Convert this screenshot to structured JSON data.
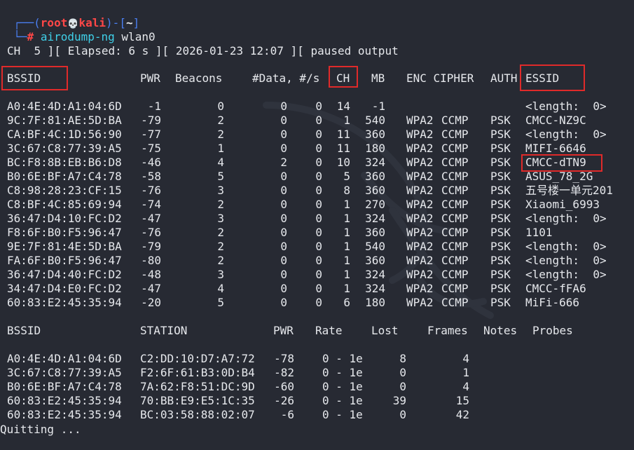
{
  "prompt": {
    "bracket_open": "┌──(",
    "user": "root",
    "skull": "💀",
    "host": "kali",
    "bracket_mid": ")-[",
    "cwd": "~",
    "bracket_close": "]",
    "corner": "└─",
    "hash": "#",
    "command": "airodump-ng",
    "arg": "wlan0"
  },
  "status_line": "CH  5 ][ Elapsed: 6 s ][ 2026-01-23 12:07 ][ paused output",
  "ap_table": {
    "headers": {
      "bssid": "BSSID",
      "pwr": "PWR",
      "beacons": "Beacons",
      "data": "#Data, #/s",
      "ch": "CH",
      "mb": "MB",
      "enc_cipher": "ENC CIPHER",
      "auth": "AUTH",
      "essid": "ESSID"
    },
    "rows": [
      {
        "bssid": "A0:4E:4D:A1:04:6D",
        "pwr": "-1",
        "beacons": "0",
        "data": "0",
        "per_s": "0",
        "ch": "14",
        "mb": "-1",
        "enc": "",
        "cipher": "",
        "auth": "",
        "essid": "<length:  0>"
      },
      {
        "bssid": "9C:7F:81:AE:5D:BA",
        "pwr": "-79",
        "beacons": "2",
        "data": "0",
        "per_s": "0",
        "ch": "1",
        "mb": "540",
        "enc": "WPA2",
        "cipher": "CCMP",
        "auth": "PSK",
        "essid": "CMCC-NZ9C"
      },
      {
        "bssid": "CA:BF:4C:1D:56:90",
        "pwr": "-77",
        "beacons": "2",
        "data": "0",
        "per_s": "0",
        "ch": "11",
        "mb": "360",
        "enc": "WPA2",
        "cipher": "CCMP",
        "auth": "PSK",
        "essid": "<length:  0>"
      },
      {
        "bssid": "3C:67:C8:77:39:A5",
        "pwr": "-75",
        "beacons": "1",
        "data": "0",
        "per_s": "0",
        "ch": "11",
        "mb": "180",
        "enc": "WPA2",
        "cipher": "CCMP",
        "auth": "PSK",
        "essid": "MIFI-6646"
      },
      {
        "bssid": "BC:F8:8B:EB:B6:D8",
        "pwr": "-46",
        "beacons": "4",
        "data": "2",
        "per_s": "0",
        "ch": "10",
        "mb": "324",
        "enc": "WPA2",
        "cipher": "CCMP",
        "auth": "PSK",
        "essid": "CMCC-dTN9"
      },
      {
        "bssid": "B0:6E:BF:A7:C4:78",
        "pwr": "-58",
        "beacons": "5",
        "data": "0",
        "per_s": "0",
        "ch": "5",
        "mb": "360",
        "enc": "WPA2",
        "cipher": "CCMP",
        "auth": "PSK",
        "essid": "ASUS_78_2G"
      },
      {
        "bssid": "C8:98:28:23:CF:15",
        "pwr": "-76",
        "beacons": "3",
        "data": "0",
        "per_s": "0",
        "ch": "8",
        "mb": "360",
        "enc": "WPA2",
        "cipher": "CCMP",
        "auth": "PSK",
        "essid": "五号楼一单元201"
      },
      {
        "bssid": "C8:BF:4C:85:69:94",
        "pwr": "-74",
        "beacons": "2",
        "data": "0",
        "per_s": "0",
        "ch": "1",
        "mb": "270",
        "enc": "WPA2",
        "cipher": "CCMP",
        "auth": "PSK",
        "essid": "Xiaomi_6993"
      },
      {
        "bssid": "36:47:D4:10:FC:D2",
        "pwr": "-47",
        "beacons": "3",
        "data": "0",
        "per_s": "0",
        "ch": "1",
        "mb": "324",
        "enc": "WPA2",
        "cipher": "CCMP",
        "auth": "PSK",
        "essid": "<length:  0>"
      },
      {
        "bssid": "F8:6F:B0:F5:96:47",
        "pwr": "-76",
        "beacons": "2",
        "data": "0",
        "per_s": "0",
        "ch": "1",
        "mb": "360",
        "enc": "WPA2",
        "cipher": "CCMP",
        "auth": "PSK",
        "essid": "1101"
      },
      {
        "bssid": "9E:7F:81:4E:5D:BA",
        "pwr": "-79",
        "beacons": "2",
        "data": "0",
        "per_s": "0",
        "ch": "1",
        "mb": "540",
        "enc": "WPA2",
        "cipher": "CCMP",
        "auth": "PSK",
        "essid": "<length:  0>"
      },
      {
        "bssid": "FA:6F:B0:F5:96:47",
        "pwr": "-80",
        "beacons": "2",
        "data": "0",
        "per_s": "0",
        "ch": "1",
        "mb": "360",
        "enc": "WPA2",
        "cipher": "CCMP",
        "auth": "PSK",
        "essid": "<length:  0>"
      },
      {
        "bssid": "36:47:D4:40:FC:D2",
        "pwr": "-48",
        "beacons": "3",
        "data": "0",
        "per_s": "0",
        "ch": "1",
        "mb": "324",
        "enc": "WPA2",
        "cipher": "CCMP",
        "auth": "PSK",
        "essid": "<length:  0>"
      },
      {
        "bssid": "34:47:D4:E0:FC:D2",
        "pwr": "-47",
        "beacons": "4",
        "data": "0",
        "per_s": "0",
        "ch": "1",
        "mb": "324",
        "enc": "WPA2",
        "cipher": "CCMP",
        "auth": "PSK",
        "essid": "CMCC-fFA6"
      },
      {
        "bssid": "60:83:E2:45:35:94",
        "pwr": "-20",
        "beacons": "5",
        "data": "0",
        "per_s": "0",
        "ch": "6",
        "mb": "180",
        "enc": "WPA2",
        "cipher": "CCMP",
        "auth": "PSK",
        "essid": "MiFi-666"
      }
    ]
  },
  "station_table": {
    "headers": {
      "bssid": "BSSID",
      "station": "STATION",
      "pwr": "PWR",
      "rate": "Rate",
      "lost": "Lost",
      "frames": "Frames",
      "notes": "Notes",
      "probes": "Probes"
    },
    "rows": [
      {
        "bssid": "A0:4E:4D:A1:04:6D",
        "station": "C2:DD:10:D7:A7:72",
        "pwr": "-78",
        "rate": "0 - 1e",
        "lost": "8",
        "frames": "4"
      },
      {
        "bssid": "3C:67:C8:77:39:A5",
        "station": "F2:6F:61:B3:0D:B4",
        "pwr": "-82",
        "rate": "0 - 1e",
        "lost": "0",
        "frames": "1"
      },
      {
        "bssid": "B0:6E:BF:A7:C4:78",
        "station": "7A:62:F8:51:DC:9D",
        "pwr": "-60",
        "rate": "0 - 1e",
        "lost": "0",
        "frames": "4"
      },
      {
        "bssid": "60:83:E2:45:35:94",
        "station": "70:BB:E9:E5:1C:35",
        "pwr": "-26",
        "rate": "0 - 1e",
        "lost": "39",
        "frames": "15"
      },
      {
        "bssid": "60:83:E2:45:35:94",
        "station": "BC:03:58:88:02:07",
        "pwr": "-6",
        "rate": "0 - 1e",
        "lost": "0",
        "frames": "42"
      }
    ]
  },
  "footer": "Quitting ...",
  "colors": {
    "background": "#272a33",
    "text": "#e6e8ec",
    "prompt_blue": "#4a7ff2",
    "prompt_red": "#ff4747",
    "command_cyan": "#3fd0e8",
    "highlight_box": "#e02a2a"
  }
}
